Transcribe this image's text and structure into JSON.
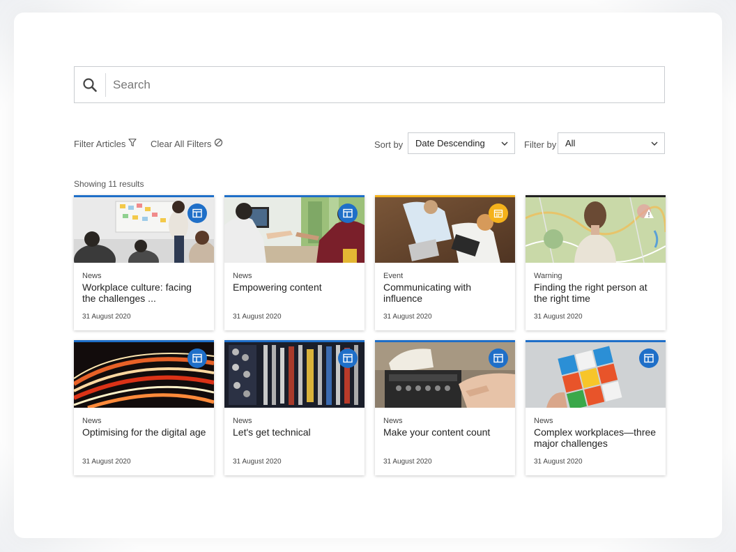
{
  "search": {
    "placeholder": "Search"
  },
  "toolbar": {
    "filter_label": "Filter Articles",
    "clear_label": "Clear All Filters",
    "sort_label": "Sort by",
    "sort_value": "Date Descending",
    "filter_by_label": "Filter by",
    "filter_by_value": "All"
  },
  "results_text": "Showing 11 results",
  "colors": {
    "news": "#1f6fc8",
    "event": "#f5b21b",
    "warning": "#222222"
  },
  "cards": [
    {
      "category": "News",
      "title": "Workplace culture: facing the challenges ...",
      "date": "31 August 2020",
      "icon": "article-icon"
    },
    {
      "category": "News",
      "title": "Empowering content",
      "date": "31 August 2020",
      "icon": "article-icon"
    },
    {
      "category": "Event",
      "title": "Communicating with influence",
      "date": "31 August 2020",
      "icon": "calendar-icon"
    },
    {
      "category": "Warning",
      "title": "Finding the right person at the right time",
      "date": "31 August 2020",
      "icon": "warning-icon"
    },
    {
      "category": "News",
      "title": "Optimising for the digital age",
      "date": "31 August 2020",
      "icon": "article-icon"
    },
    {
      "category": "News",
      "title": "Let's get technical",
      "date": "31 August 2020",
      "icon": "article-icon"
    },
    {
      "category": "News",
      "title": "Make your content count",
      "date": "31 August 2020",
      "icon": "article-icon"
    },
    {
      "category": "News",
      "title": "Complex workplaces—three major challenges",
      "date": "31 August 2020",
      "icon": "article-icon"
    }
  ]
}
